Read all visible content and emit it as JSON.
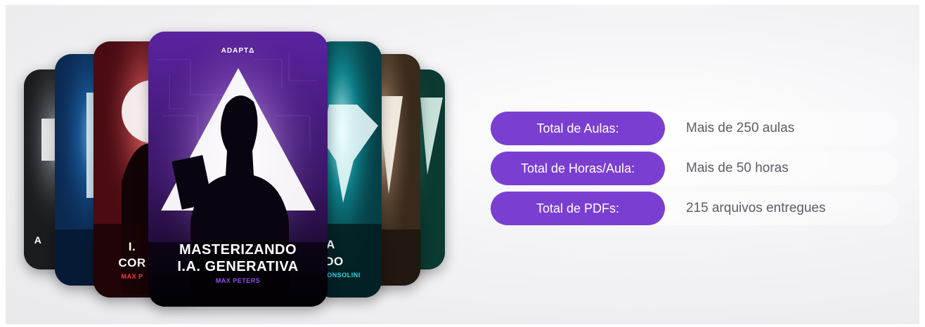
{
  "cards": {
    "c1": {
      "title": "A"
    },
    "c2": {
      "title": ""
    },
    "c3": {
      "title_line1": "I.",
      "title_line2": "COR",
      "author": "MAX P"
    },
    "c4": {
      "brand": "ADAPTΔ",
      "title_line1": "MASTERIZANDO",
      "title_line2": "I.A. GENERATIVA",
      "author": "MAX PETERS"
    },
    "c5": {
      "title_line1": "A",
      "title_line2": "DO",
      "author": "CONSOLINI"
    }
  },
  "info": {
    "rows": [
      {
        "label": "Total de Aulas:",
        "value": "Mais de 250 aulas"
      },
      {
        "label": "Total de Horas/Aula:",
        "value": "Mais de 50 horas"
      },
      {
        "label": "Total de PDFs:",
        "value": "215 arquivos entregues"
      }
    ]
  },
  "colors": {
    "accent": "#7a3fd1",
    "card_purple": "#3b1563",
    "card_red": "#4a0b12",
    "card_blue": "#0b2a52",
    "card_teal": "#064046",
    "card_brown": "#3a2a1c",
    "card_green": "#0b3a33",
    "card_dark": "#1b1c1f"
  }
}
